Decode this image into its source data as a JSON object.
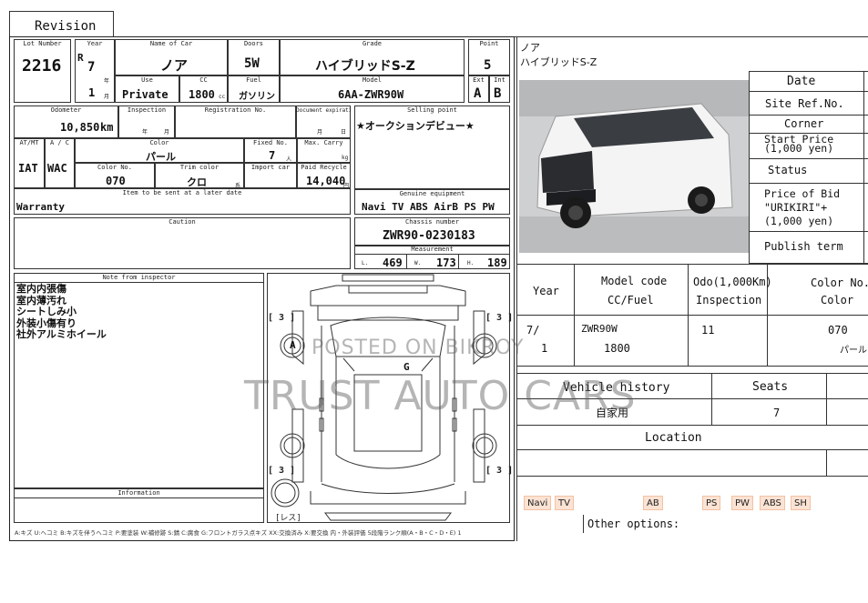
{
  "revision_tab": "Revision",
  "sheet": {
    "headers": {
      "lot_number": "Lot Number",
      "year": "Year",
      "name_of_car": "Name of Car",
      "doors": "Doors",
      "grade": "Grade",
      "point": "Point",
      "use": "Use",
      "cc": "CC",
      "fuel": "Fuel",
      "model": "Model",
      "ext": "Ext",
      "int": "Int",
      "odometer": "Odometer",
      "inspection": "Inspection",
      "registration_no": "Registration No.",
      "document_expiration": "Document expiration",
      "selling_point": "Selling point",
      "at_mt": "AT/MT",
      "a_c": "A / C",
      "color": "Color",
      "fixed_no": "Fixed No.",
      "max_carry": "Max. Carry",
      "color_no": "Color No.",
      "trim_color": "Trim color",
      "import_car": "Import car",
      "paid_recycle": "Paid Recycle",
      "item_later": "Item to be sent at a later date",
      "genuine_equipment": "Genuine equipment",
      "caution": "Caution",
      "chassis_number": "Chassis number",
      "measurement": "Measurement",
      "note_from_inspector": "Note from inspector",
      "information": "Information"
    },
    "lot_number": "2216",
    "era": "R",
    "year": "7",
    "year_unit": "年",
    "month": "1",
    "month_unit": "月",
    "name_of_car": "ノア",
    "doors": "5W",
    "grade": "ハイブリッドS-Z",
    "point": "5",
    "use": "Private",
    "cc": "1800",
    "cc_unit": "cc",
    "fuel": "ガソリン",
    "model": "6AA-ZWR90W",
    "ext": "A",
    "int": "B",
    "odometer": "10,850",
    "odometer_unit": "km",
    "inspection_year_unit": "年",
    "inspection_month_unit": "月",
    "doc_month_unit": "月",
    "doc_day_unit": "日",
    "selling_point_text": "★オークションデビュー★",
    "at_mt": "IAT",
    "a_c": "WAC",
    "color": "パール",
    "fixed_no": "7",
    "fixed_no_unit": "人",
    "max_carry_unit": "kg",
    "color_no": "070",
    "trim_color": "クロ",
    "trim_unit": "系",
    "paid_recycle": "14,040",
    "paid_recycle_unit": "円",
    "warranty": "Warranty",
    "genuine_equipment": "Navi TV ABS AirB PS PW",
    "chassis_number": "ZWR90-0230183",
    "meas_l_label": "L.",
    "meas_l": "469",
    "meas_w_label": "W.",
    "meas_w": "173",
    "meas_h_label": "H.",
    "meas_h": "189",
    "notes": [
      "室内内張傷",
      "室内薄汚れ",
      "シートしみ小",
      "外装小傷有り",
      "社外アルミホイール"
    ],
    "diagram": {
      "tire_marks": [
        "[ 3 ]",
        "[ 3 ]",
        "[ 3 ]",
        "[ 3 ]"
      ],
      "spare_label": "[レス]",
      "mark_a": "A",
      "mark_g": "G"
    },
    "legend": "A:キズ U:ヘコミ B:キズを伴うヘコミ P:要塗装 W:補修跡 S:錆 C:腐食 G:フロントガラス点キズ XX:交換済み X:要交換 内・外装評価 5段階ランク順(A・B・C・D・E) 1"
  },
  "watermark": {
    "line1": "POSTED ON BIKROY",
    "line2": "TRUST AUTO CARS"
  },
  "right_panel": {
    "car_name": "ノア",
    "car_grade": "ハイブリッドS-Z",
    "side_labels": [
      "Date",
      "Site Ref.No.",
      "Corner",
      "Start Price\n(1,000 yen)",
      "Status",
      "Price of Bid\n\"URIKIRI\"+\n(1,000 yen)",
      "Publish term"
    ],
    "table_headers": {
      "year": "Year",
      "model_code": "Model code",
      "cc_fuel": "CC/Fuel",
      "odo": "Odo(1,000Km)",
      "inspection": "Inspection",
      "color_no": "Color No.",
      "color": "Color"
    },
    "table_values": {
      "year": "7/",
      "month": "1",
      "model_code": "ZWR90W",
      "cc": "1800",
      "odo": "11",
      "color_no": "070",
      "color": "パール"
    },
    "vehicle_history_label": "Vehicle history",
    "seats_label": "Seats",
    "vehicle_history": "自家用",
    "seats": "7",
    "location_label": "Location",
    "options": [
      "Navi",
      "TV",
      "AB",
      "PS",
      "PW",
      "ABS",
      "SH"
    ],
    "other_options_label": "Other options:"
  }
}
